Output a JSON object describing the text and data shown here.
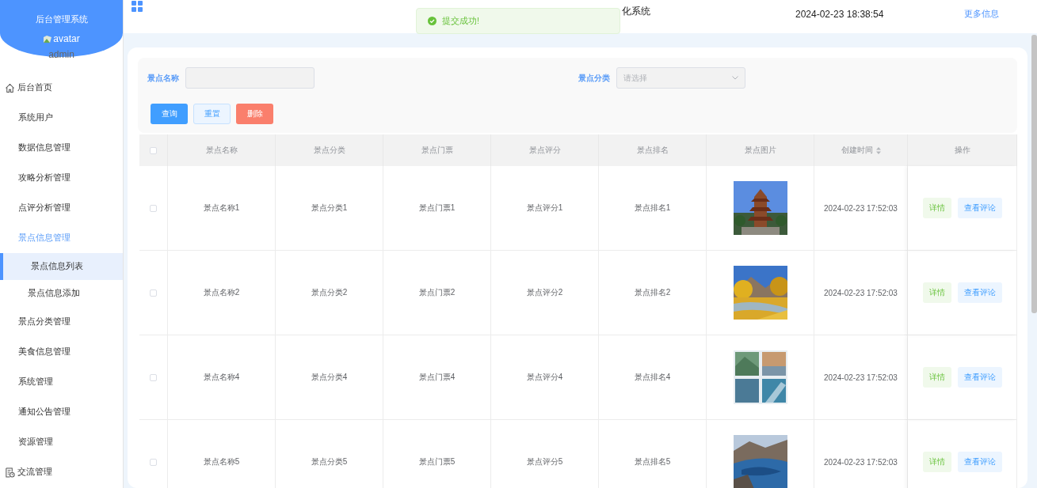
{
  "sidebar": {
    "title": "后台管理系统",
    "avatar_alt": "avatar",
    "username": "admin",
    "items": [
      {
        "label": "后台首页",
        "selected": false
      },
      {
        "label": "系统用户",
        "selected": false
      },
      {
        "label": "数据信息管理",
        "selected": false
      },
      {
        "label": "攻略分析管理",
        "selected": false
      },
      {
        "label": "点评分析管理",
        "selected": false
      },
      {
        "label": "景点信息管理",
        "selected": true,
        "children": [
          {
            "label": "景点信息列表",
            "selected": true
          },
          {
            "label": "景点信息添加",
            "selected": false
          }
        ]
      },
      {
        "label": "景点分类管理",
        "selected": false
      },
      {
        "label": "美食信息管理",
        "selected": false
      },
      {
        "label": "系统管理",
        "selected": false
      },
      {
        "label": "通知公告管理",
        "selected": false
      },
      {
        "label": "资源管理",
        "selected": false
      },
      {
        "label": "交流管理",
        "selected": false
      }
    ]
  },
  "header": {
    "title": "化系统",
    "datetime": "2024-02-23 18:38:54",
    "more_link": "更多信息"
  },
  "toast": {
    "kind": "success",
    "message": "提交成功!"
  },
  "search": {
    "fields": [
      {
        "label": "景点名称",
        "kind": "text"
      },
      {
        "label": "景点分类",
        "kind": "select",
        "placeholder": "请选择"
      }
    ],
    "buttons": [
      {
        "label": "查询",
        "kind": "primary"
      },
      {
        "label": "重置",
        "kind": "plain"
      },
      {
        "label": "删除",
        "kind": "danger"
      }
    ]
  },
  "table": {
    "select_all_checked": false,
    "columns": [
      {
        "label": "景点名称"
      },
      {
        "label": "景点分类"
      },
      {
        "label": "景点门票"
      },
      {
        "label": "景点评分"
      },
      {
        "label": "景点排名"
      },
      {
        "label": "景点图片"
      },
      {
        "label": "创建时间",
        "sortable": true
      },
      {
        "label": "操作"
      }
    ],
    "rows": [
      {
        "checked": false,
        "cells": [
          "景点名称1",
          "景点分类1",
          "景点门票1",
          "景点评分1",
          "景点排名1"
        ],
        "image": {
          "kind": "picture"
        },
        "created": "2024-02-23 17:52:03",
        "actions": [
          "详情",
          "查看评论"
        ]
      },
      {
        "checked": false,
        "cells": [
          "景点名称2",
          "景点分类2",
          "景点门票2",
          "景点评分2",
          "景点排名2"
        ],
        "image": {
          "kind": "picture"
        },
        "created": "2024-02-23 17:52:03",
        "actions": [
          "详情",
          "查看评论"
        ]
      },
      {
        "checked": false,
        "cells": [
          "景点名称4",
          "景点分类4",
          "景点门票4",
          "景点评分4",
          "景点排名4"
        ],
        "image": {
          "kind": "picture"
        },
        "created": "2024-02-23 17:52:03",
        "actions": [
          "详情",
          "查看评论"
        ]
      },
      {
        "checked": false,
        "cells": [
          "景点名称5",
          "景点分类5",
          "景点门票5",
          "景点评分5",
          "景点排名5"
        ],
        "image": {
          "kind": "picture"
        },
        "created": "2024-02-23 17:52:03",
        "actions": [
          "详情",
          "查看评论"
        ]
      }
    ]
  }
}
